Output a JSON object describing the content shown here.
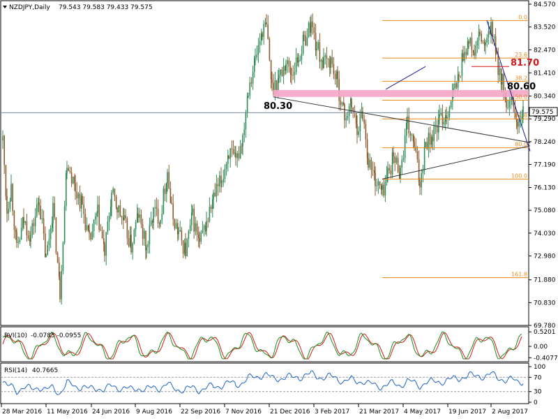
{
  "header": {
    "symbol_label": "NZDJPY,Daily",
    "ohlc": "79.543 79.583 79.433 79.575"
  },
  "colors": {
    "bull": "#2e8b57",
    "bear": "#a0522d",
    "candle": "#8b5a2b",
    "fib": "#e8891a",
    "zone": "#f4a6c8",
    "trend": "#333333",
    "blue_line": "#1a1a9c",
    "rvi_green": "#1a8a1a",
    "rvi_red": "#d01818",
    "rsi": "#1e64c8",
    "current_box": "#ffffff"
  },
  "chart_data": [
    {
      "type": "candlestick",
      "title": "NZDJPY,Daily",
      "ylim": [
        69.78,
        84.57
      ],
      "y_ticks": [
        "84.570",
        "83.520",
        "82.470",
        "81.410",
        "80.340",
        "79.290",
        "78.240",
        "77.190",
        "76.130",
        "75.080",
        "74.030",
        "72.980",
        "71.880",
        "70.830",
        "69.780"
      ],
      "x_ticks": [
        "28 Mar 2016",
        "11 May 2016",
        "24 Jun 2016",
        "9 Aug 2016",
        "22 Sep 2016",
        "7 Nov 2016",
        "21 Dec 2016",
        "3 Feb 2017",
        "21 Mar 2017",
        "4 May 2017",
        "19 Jun 2017",
        "2 Aug 2017"
      ],
      "current_price": "79.575",
      "anchors": [
        [
          0,
          78.3
        ],
        [
          6,
          75.1
        ],
        [
          12,
          76.2
        ],
        [
          20,
          73.2
        ],
        [
          30,
          74.6
        ],
        [
          40,
          73.9
        ],
        [
          52,
          75.6
        ],
        [
          62,
          72.8
        ],
        [
          72,
          75.2
        ],
        [
          82,
          71.3
        ],
        [
          92,
          77.4
        ],
        [
          104,
          76.1
        ],
        [
          114,
          75.3
        ],
        [
          124,
          73.6
        ],
        [
          136,
          74.9
        ],
        [
          146,
          73.1
        ],
        [
          156,
          75.8
        ],
        [
          164,
          75.2
        ],
        [
          174,
          74.5
        ],
        [
          184,
          73.4
        ],
        [
          194,
          74.9
        ],
        [
          206,
          73.3
        ],
        [
          216,
          75.0
        ],
        [
          226,
          74.8
        ],
        [
          236,
          76.9
        ],
        [
          242,
          75.0
        ],
        [
          252,
          74.0
        ],
        [
          262,
          73.2
        ],
        [
          272,
          74.8
        ],
        [
          282,
          73.5
        ],
        [
          292,
          74.5
        ],
        [
          302,
          75.6
        ],
        [
          314,
          76.5
        ],
        [
          324,
          77.8
        ],
        [
          334,
          77.2
        ],
        [
          344,
          78.5
        ],
        [
          352,
          80.8
        ],
        [
          362,
          82.0
        ],
        [
          372,
          83.4
        ],
        [
          378,
          83.5
        ],
        [
          386,
          80.7
        ],
        [
          396,
          81.2
        ],
        [
          406,
          81.9
        ],
        [
          414,
          81.4
        ],
        [
          424,
          82.1
        ],
        [
          432,
          82.9
        ],
        [
          442,
          83.7
        ],
        [
          450,
          82.6
        ],
        [
          460,
          81.8
        ],
        [
          470,
          82.0
        ],
        [
          480,
          80.9
        ],
        [
          490,
          79.4
        ],
        [
          500,
          79.9
        ],
        [
          508,
          78.9
        ],
        [
          516,
          79.6
        ],
        [
          524,
          77.4
        ],
        [
          534,
          76.5
        ],
        [
          544,
          75.9
        ],
        [
          552,
          76.8
        ],
        [
          560,
          77.5
        ],
        [
          570,
          76.9
        ],
        [
          580,
          79.0
        ],
        [
          590,
          78.0
        ],
        [
          598,
          76.3
        ],
        [
          606,
          78.3
        ],
        [
          616,
          78.5
        ],
        [
          626,
          79.2
        ],
        [
          636,
          79.5
        ],
        [
          646,
          80.5
        ],
        [
          654,
          81.2
        ],
        [
          660,
          82.3
        ],
        [
          668,
          82.8
        ],
        [
          676,
          82.3
        ],
        [
          684,
          83.1
        ],
        [
          692,
          82.5
        ],
        [
          700,
          83.6
        ],
        [
          708,
          82.0
        ],
        [
          716,
          81.0
        ],
        [
          722,
          79.6
        ],
        [
          730,
          80.0
        ],
        [
          738,
          79.0
        ],
        [
          746,
          79.55
        ]
      ],
      "fib_levels": [
        {
          "label": "0.0",
          "price": 83.82
        },
        {
          "label": "23.6",
          "price": 82.09
        },
        {
          "label": "38.2",
          "price": 81.02
        },
        {
          "label": "50.0",
          "price": 80.15
        },
        {
          "label": "61.8",
          "price": 79.29
        },
        {
          "label": "80.0",
          "price": 77.96
        },
        {
          "label": "100.0",
          "price": 76.52
        },
        {
          "label": "161.8",
          "price": 71.98
        }
      ],
      "annotations": [
        {
          "text": "80.30",
          "color": "#000000"
        },
        {
          "text": "80.60",
          "color": "#000000"
        },
        {
          "text": "81.70",
          "color": "#d01818"
        }
      ]
    },
    {
      "type": "line",
      "title": "RVI(10)",
      "values_label": "-0.0785 -0.0955",
      "y_ticks": [
        "0.5201",
        "0.00",
        "-0.4077"
      ],
      "ylim": [
        -0.5,
        0.6
      ],
      "series": [
        {
          "name": "RVI",
          "color": "green"
        },
        {
          "name": "Signal",
          "color": "red"
        }
      ]
    },
    {
      "type": "line",
      "title": "RSI(14)",
      "values_label": "40.7665",
      "y_ticks": [
        "100",
        "70",
        "30",
        "0"
      ],
      "ylim": [
        0,
        100
      ],
      "levels": [
        30,
        70
      ]
    }
  ]
}
